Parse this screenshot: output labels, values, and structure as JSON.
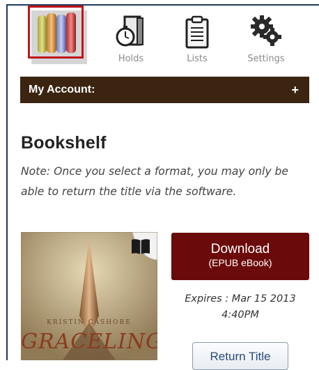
{
  "toolbar": {
    "bookshelf": {
      "label": "",
      "icon": "bookshelf-icon"
    },
    "holds": {
      "label": "Holds",
      "icon": "stopwatch-book-icon"
    },
    "lists": {
      "label": "Lists",
      "icon": "clipboard-list-icon"
    },
    "settings": {
      "label": "Settings",
      "icon": "gears-icon"
    }
  },
  "account_bar": {
    "label": "My Account:",
    "expand": "+"
  },
  "page": {
    "heading": "Bookshelf",
    "note": "Note: Once you select a format, you may only be able to return the title via the software."
  },
  "item": {
    "cover": {
      "author": "KRISTIN CASHORE",
      "title": "GRACELING"
    },
    "download_label": "Download",
    "download_format": "(EPUB eBook)",
    "expires": "Expires : Mar 15 2013 4:40PM",
    "return_label": "Return Title"
  },
  "colors": {
    "accent_bar": "#3b2510",
    "download_button": "#6b0a0a",
    "selection_box": "#c0161b"
  }
}
